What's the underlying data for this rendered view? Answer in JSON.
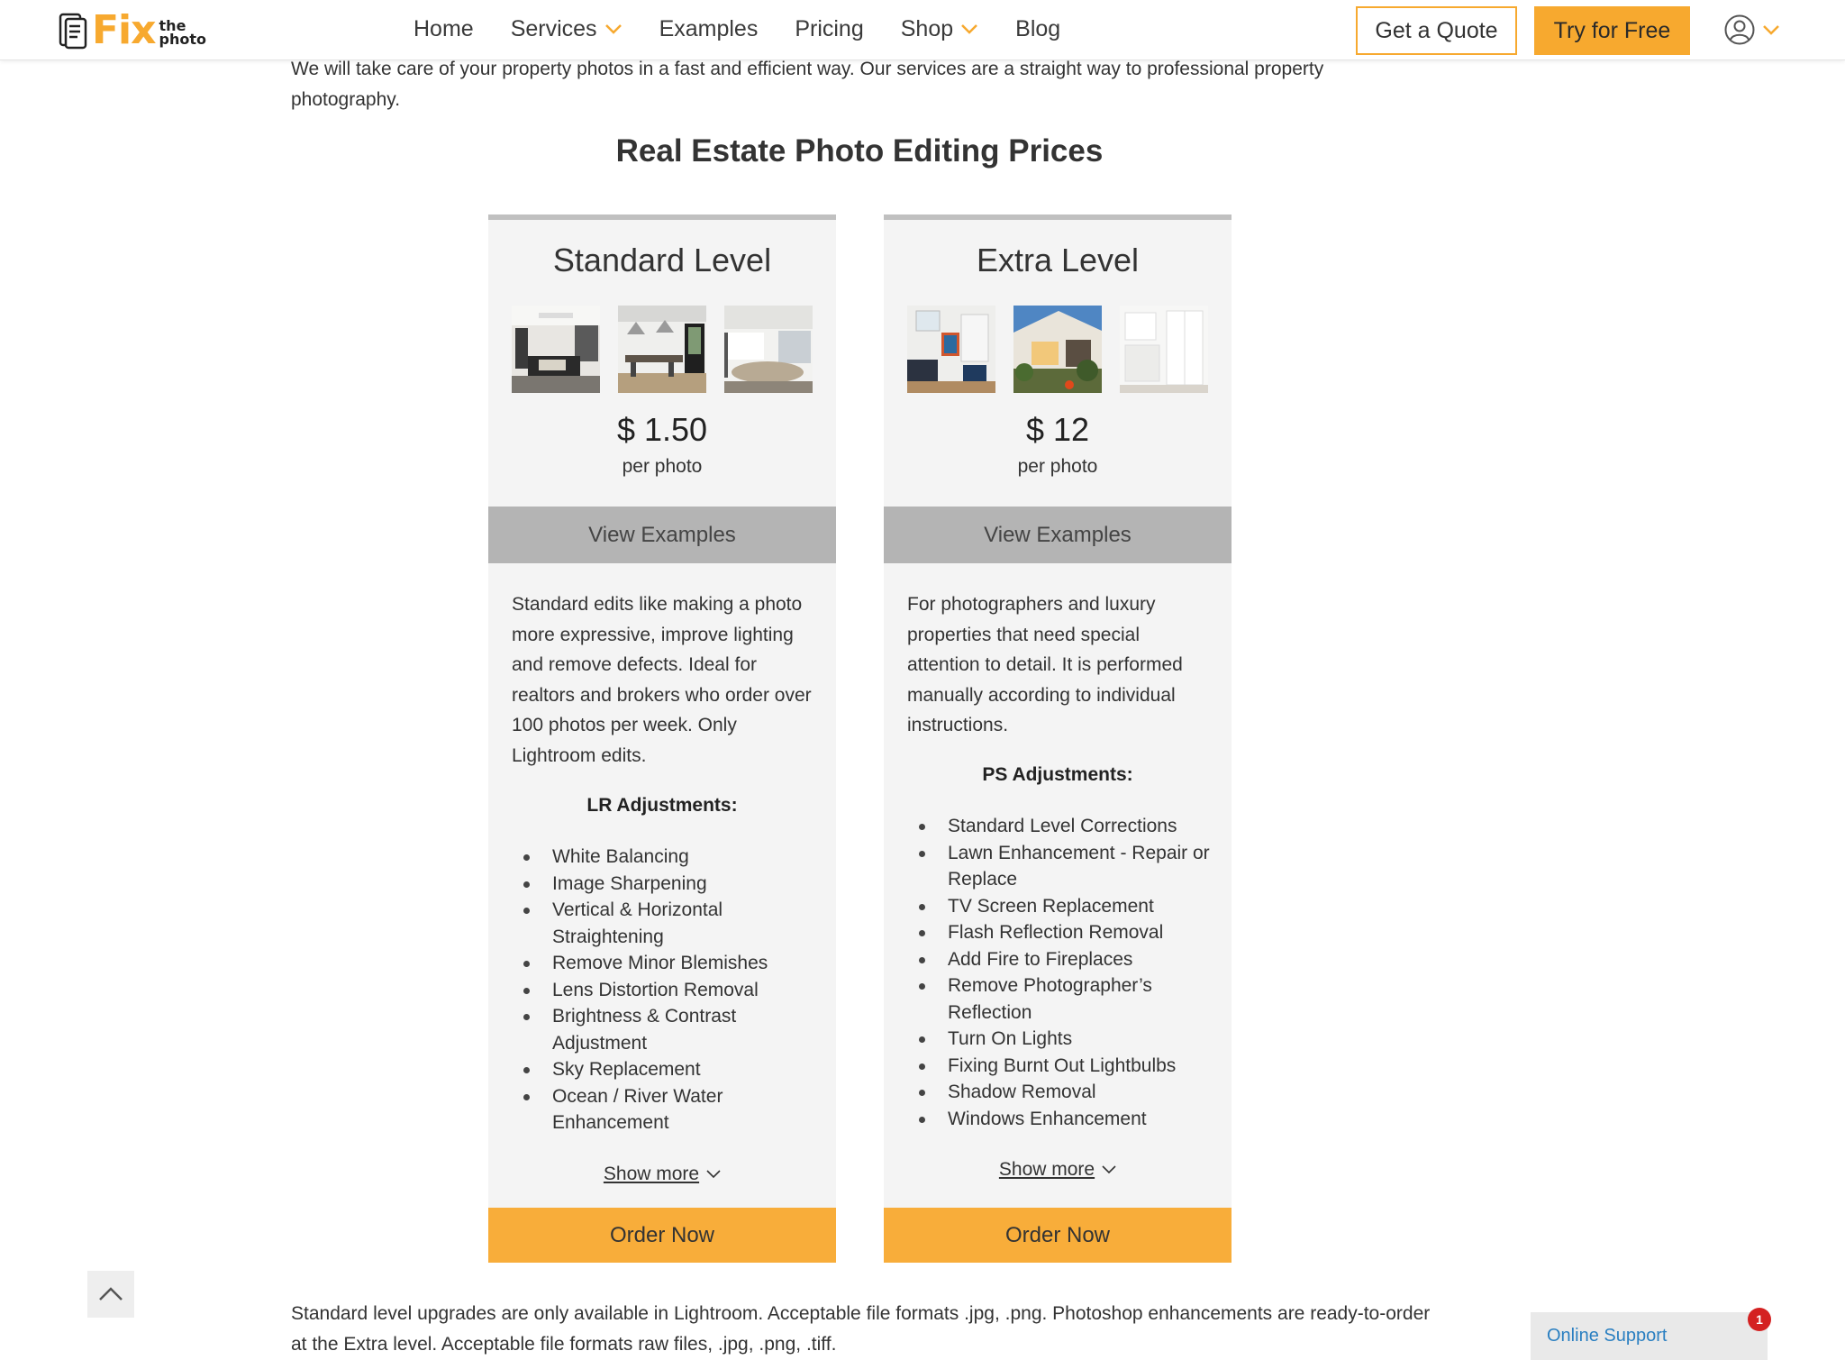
{
  "header": {
    "logo": {
      "brand": "Fix",
      "sub_top": "the",
      "sub_bottom": "photo"
    },
    "nav": [
      {
        "label": "Home",
        "has_dropdown": false
      },
      {
        "label": "Services",
        "has_dropdown": true
      },
      {
        "label": "Examples",
        "has_dropdown": false
      },
      {
        "label": "Pricing",
        "has_dropdown": false
      },
      {
        "label": "Shop",
        "has_dropdown": true
      },
      {
        "label": "Blog",
        "has_dropdown": false
      }
    ],
    "quote_button": "Get a Quote",
    "try_button": "Try for Free",
    "user_icon": "user-circle-icon"
  },
  "intro": "We will take care of your property photos in a fast and efficient way. Our services are a straight way to professional property photography.",
  "section_title": "Real Estate Photo Editing Prices",
  "cards": [
    {
      "title": "Standard Level",
      "price": "$ 1.50",
      "per": "per photo",
      "view_button": "View Examples",
      "description": "Standard edits like making a photo more expressive, improve lighting and remove defects. Ideal for realtors and brokers who order over 100 photos per week. Only Lightroom edits.",
      "adjustments_heading": "LR Adjustments:",
      "adjustments": [
        "White Balancing",
        "Image Sharpening",
        "Vertical & Horizontal Straightening",
        "Remove Minor Blemishes",
        "Lens Distortion Removal",
        "Brightness & Contrast Adjustment",
        "Sky Replacement",
        "Ocean / River Water Enhancement"
      ],
      "show_more": "Show more",
      "order_button": "Order Now"
    },
    {
      "title": "Extra Level",
      "price": "$ 12",
      "per": "per photo",
      "view_button": "View Examples",
      "description": "For photographers and luxury properties that need special attention to detail. It is performed manually according to individual instructions.",
      "adjustments_heading": "PS Adjustments:",
      "adjustments": [
        "Standard Level Corrections",
        "Lawn Enhancement - Repair or Replace",
        "TV Screen Replacement",
        "Flash Reflection Removal",
        "Add Fire to Fireplaces",
        "Remove Photographer’s Reflection",
        "Turn On Lights",
        "Fixing Burnt Out Lightbulbs",
        "Shadow Removal",
        "Windows Enhancement"
      ],
      "show_more": "Show more",
      "order_button": "Order Now"
    }
  ],
  "footnote": "Standard level upgrades are only available in Lightroom. Acceptable file formats .jpg, .png. Photoshop enhancements are ready-to-order at the Extra level. Acceptable file formats raw files, .jpg, .png, .tiff.",
  "support": {
    "label": "Online Support",
    "badge": "1"
  },
  "colors": {
    "accent": "#f7a92f",
    "card_bg": "#f4f4f4",
    "view_button_bg": "#b4b4b4",
    "support_text": "#2a7fc1",
    "badge": "#d42121"
  }
}
